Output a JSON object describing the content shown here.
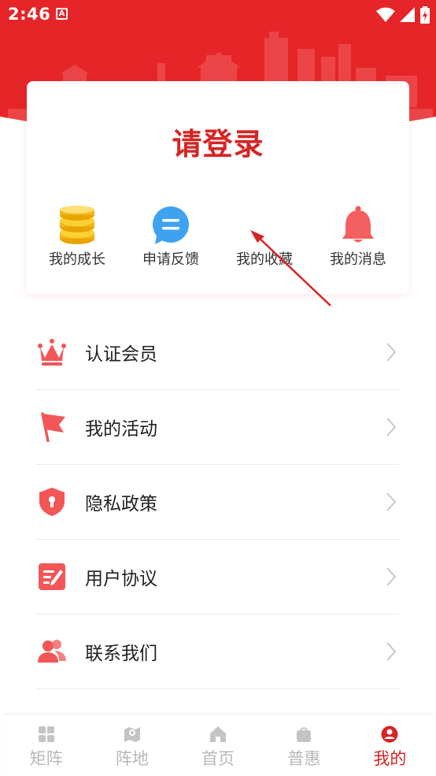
{
  "status_bar": {
    "time": "2:46",
    "notification_glyph": "A"
  },
  "profile": {
    "login_prompt": "请登录",
    "quick_actions": [
      {
        "label": "我的成长",
        "icon": "coins-icon"
      },
      {
        "label": "申请反馈",
        "icon": "chat-bubble-icon"
      },
      {
        "label": "我的收藏",
        "icon": "favorites-icon"
      },
      {
        "label": "我的消息",
        "icon": "bell-icon"
      }
    ]
  },
  "menu": {
    "items": [
      {
        "label": "认证会员",
        "icon": "crown-icon"
      },
      {
        "label": "我的活动",
        "icon": "flag-icon"
      },
      {
        "label": "隐私政策",
        "icon": "shield-lock-icon"
      },
      {
        "label": "用户协议",
        "icon": "edit-document-icon"
      },
      {
        "label": "联系我们",
        "icon": "contacts-icon"
      }
    ]
  },
  "bottom_nav": {
    "items": [
      {
        "label": "矩阵",
        "icon": "grid-icon",
        "active": false
      },
      {
        "label": "阵地",
        "icon": "map-pin-icon",
        "active": false
      },
      {
        "label": "首页",
        "icon": "home-icon",
        "active": false
      },
      {
        "label": "普惠",
        "icon": "bag-icon",
        "active": false
      },
      {
        "label": "我的",
        "icon": "user-icon",
        "active": true
      }
    ]
  },
  "colors": {
    "brand_red": "#e52528",
    "title_red": "#d62424",
    "icon_red": "#f05a5a",
    "inactive_gray": "#b8b8b8"
  }
}
